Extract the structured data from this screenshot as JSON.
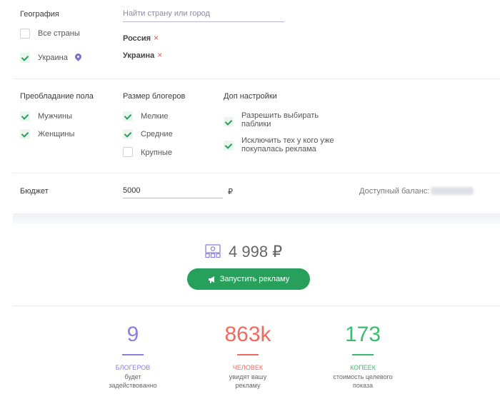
{
  "geo": {
    "label": "География",
    "search_placeholder": "Найти страну или город",
    "all_countries": "Все страны",
    "ukraine": "Украина",
    "tags": [
      {
        "name": "Россия",
        "remove": "×"
      },
      {
        "name": "Украина",
        "remove": "×"
      }
    ]
  },
  "gender": {
    "title": "Преобладание пола",
    "male": "Мужчины",
    "female": "Женщины"
  },
  "size": {
    "title": "Размер блогеров",
    "small": "Мелкие",
    "medium": "Средние",
    "large": "Крупные"
  },
  "extra": {
    "title": "Доп настройки",
    "opt1_line1": "Разрешить выбирать",
    "opt1_line2": "паблики",
    "opt2_line1": "Исключить тех у кого уже",
    "opt2_line2": "покупалась реклама"
  },
  "budget": {
    "label": "Бюджет",
    "value": "5000",
    "currency": "₽",
    "balance_label": "Доступный баланс:"
  },
  "summary": {
    "total": "4 998 ₽",
    "launch_label": "Запустить рекламу"
  },
  "stats": [
    {
      "number": "9",
      "title": "БЛОГЕРОВ",
      "desc1": "будет",
      "desc2": "задействованно",
      "color": "#8b7fe0"
    },
    {
      "number": "863k",
      "title": "ЧЕЛОВЕК",
      "desc1": "увидят вашу",
      "desc2": "рекламу",
      "color": "#ef6b5e"
    },
    {
      "number": "173",
      "title": "КОПЕЕК",
      "desc1": "стоимость целевого",
      "desc2": "показа",
      "color": "#3dbb6e"
    }
  ],
  "colors": {
    "accent": "#27a05b",
    "check": "#2aa05a",
    "remove": "#e05a5a"
  }
}
